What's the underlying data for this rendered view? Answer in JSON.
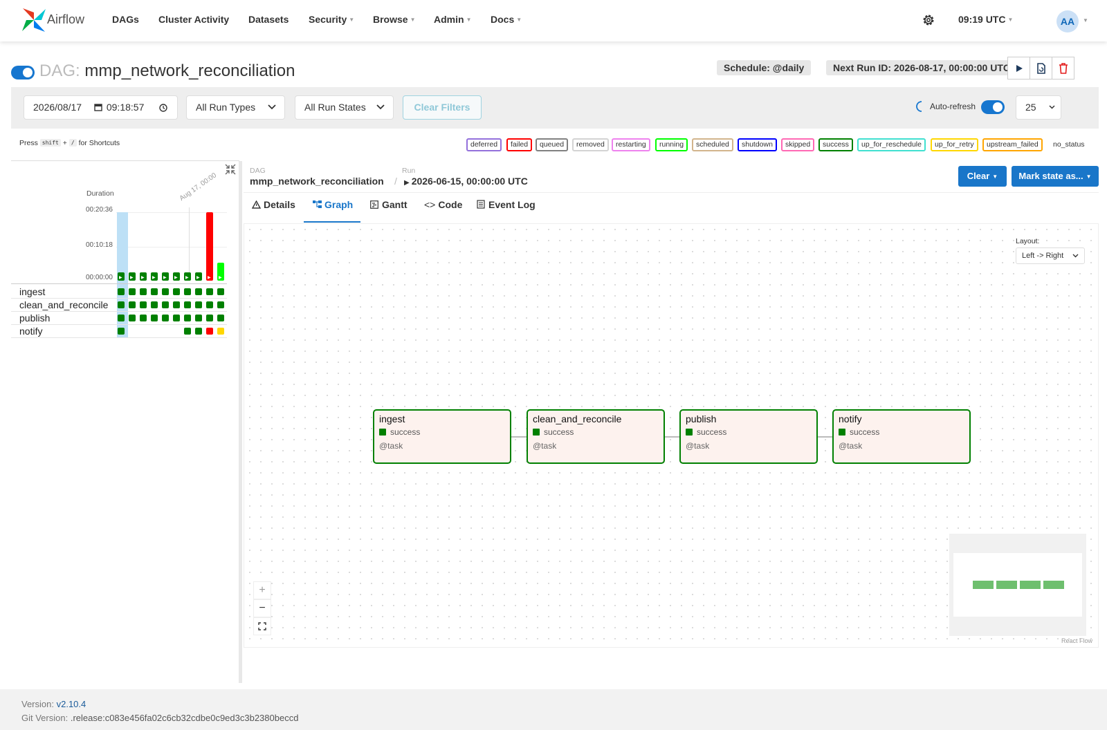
{
  "nav": {
    "brand": "Airflow",
    "links": [
      "DAGs",
      "Cluster Activity",
      "Datasets",
      "Security",
      "Browse",
      "Admin",
      "Docs"
    ],
    "time": "09:19 UTC",
    "avatar": "AA"
  },
  "dag": {
    "prefix": "DAG:",
    "name": "mmp_network_reconciliation",
    "schedule": "Schedule: @daily",
    "next_run": "Next Run ID: 2026-08-17, 00:00:00 UTC"
  },
  "filters": {
    "date": "2026/08/17",
    "time": "09:18:57",
    "run_types": "All Run Types",
    "run_states": "All Run States",
    "clear_filters": "Clear Filters",
    "auto_refresh": "Auto-refresh",
    "page_size": "25"
  },
  "shortcuts": {
    "press": "Press",
    "shift": "shift",
    "plus": "+",
    "slash": "/",
    "for": "for Shortcuts"
  },
  "legend": [
    {
      "label": "deferred",
      "color": "#9370db"
    },
    {
      "label": "failed",
      "color": "#ff0000"
    },
    {
      "label": "queued",
      "color": "#808080"
    },
    {
      "label": "removed",
      "color": "#d3d3d3"
    },
    {
      "label": "restarting",
      "color": "#ee82ee"
    },
    {
      "label": "running",
      "color": "#00ff00"
    },
    {
      "label": "scheduled",
      "color": "#d2b48c"
    },
    {
      "label": "shutdown",
      "color": "#0000ff"
    },
    {
      "label": "skipped",
      "color": "#ff69b4"
    },
    {
      "label": "success",
      "color": "#008000"
    },
    {
      "label": "up_for_reschedule",
      "color": "#40e0d0"
    },
    {
      "label": "up_for_retry",
      "color": "#ffd700"
    },
    {
      "label": "upstream_failed",
      "color": "#ffa500"
    },
    {
      "label": "no_status",
      "color": ""
    }
  ],
  "grid": {
    "duration_label": "Duration",
    "ticks": [
      "00:20:36",
      "00:10:18",
      "00:00:00"
    ],
    "date_marker": "Aug 17, 00:00",
    "runs": [
      {
        "duration_fraction": 0.12,
        "state": "success",
        "selected": true
      },
      {
        "duration_fraction": 0.12,
        "state": "success"
      },
      {
        "duration_fraction": 0.12,
        "state": "success"
      },
      {
        "duration_fraction": 0.12,
        "state": "success"
      },
      {
        "duration_fraction": 0.12,
        "state": "success"
      },
      {
        "duration_fraction": 0.12,
        "state": "success"
      },
      {
        "duration_fraction": 0.12,
        "state": "success"
      },
      {
        "duration_fraction": 0.12,
        "state": "success"
      },
      {
        "duration_fraction": 1.0,
        "state": "failed"
      },
      {
        "duration_fraction": 0.26,
        "state": "running"
      }
    ],
    "tasks": [
      {
        "name": "ingest",
        "states": [
          "success",
          "success",
          "success",
          "success",
          "success",
          "success",
          "success",
          "success",
          "success",
          "success"
        ]
      },
      {
        "name": "clean_and_reconcile",
        "states": [
          "success",
          "success",
          "success",
          "success",
          "success",
          "success",
          "success",
          "success",
          "success",
          "success"
        ]
      },
      {
        "name": "publish",
        "states": [
          "success",
          "success",
          "success",
          "success",
          "success",
          "success",
          "success",
          "success",
          "success",
          "success"
        ]
      },
      {
        "name": "notify",
        "states": [
          "success",
          "",
          "",
          "",
          "",
          "",
          "success",
          "success",
          "failed",
          "up_for_retry"
        ]
      }
    ]
  },
  "breadcrumb": {
    "dag_label": "DAG",
    "dag_value": "mmp_network_reconciliation",
    "run_label": "Run",
    "run_value": "2026-06-15, 00:00:00 UTC"
  },
  "actions": {
    "clear": "Clear",
    "mark_state": "Mark state as..."
  },
  "tabs": [
    "Details",
    "Graph",
    "Gantt",
    "Code",
    "Event Log"
  ],
  "active_tab": "Graph",
  "graph": {
    "layout_label": "Layout:",
    "layout_value": "Left -> Right",
    "attribution": "React Flow",
    "nodes": [
      {
        "label": "ingest",
        "state": "success",
        "operator": "@task"
      },
      {
        "label": "clean_and_reconcile",
        "state": "success",
        "operator": "@task"
      },
      {
        "label": "publish",
        "state": "success",
        "operator": "@task"
      },
      {
        "label": "notify",
        "state": "success",
        "operator": "@task"
      }
    ]
  },
  "footer": {
    "version_label": "Version:",
    "version": "v2.10.4",
    "git_label": "Git Version:",
    "git": ".release:c083e456fa02c6cb32cdbe0c9ed3c3b2380beccd"
  }
}
